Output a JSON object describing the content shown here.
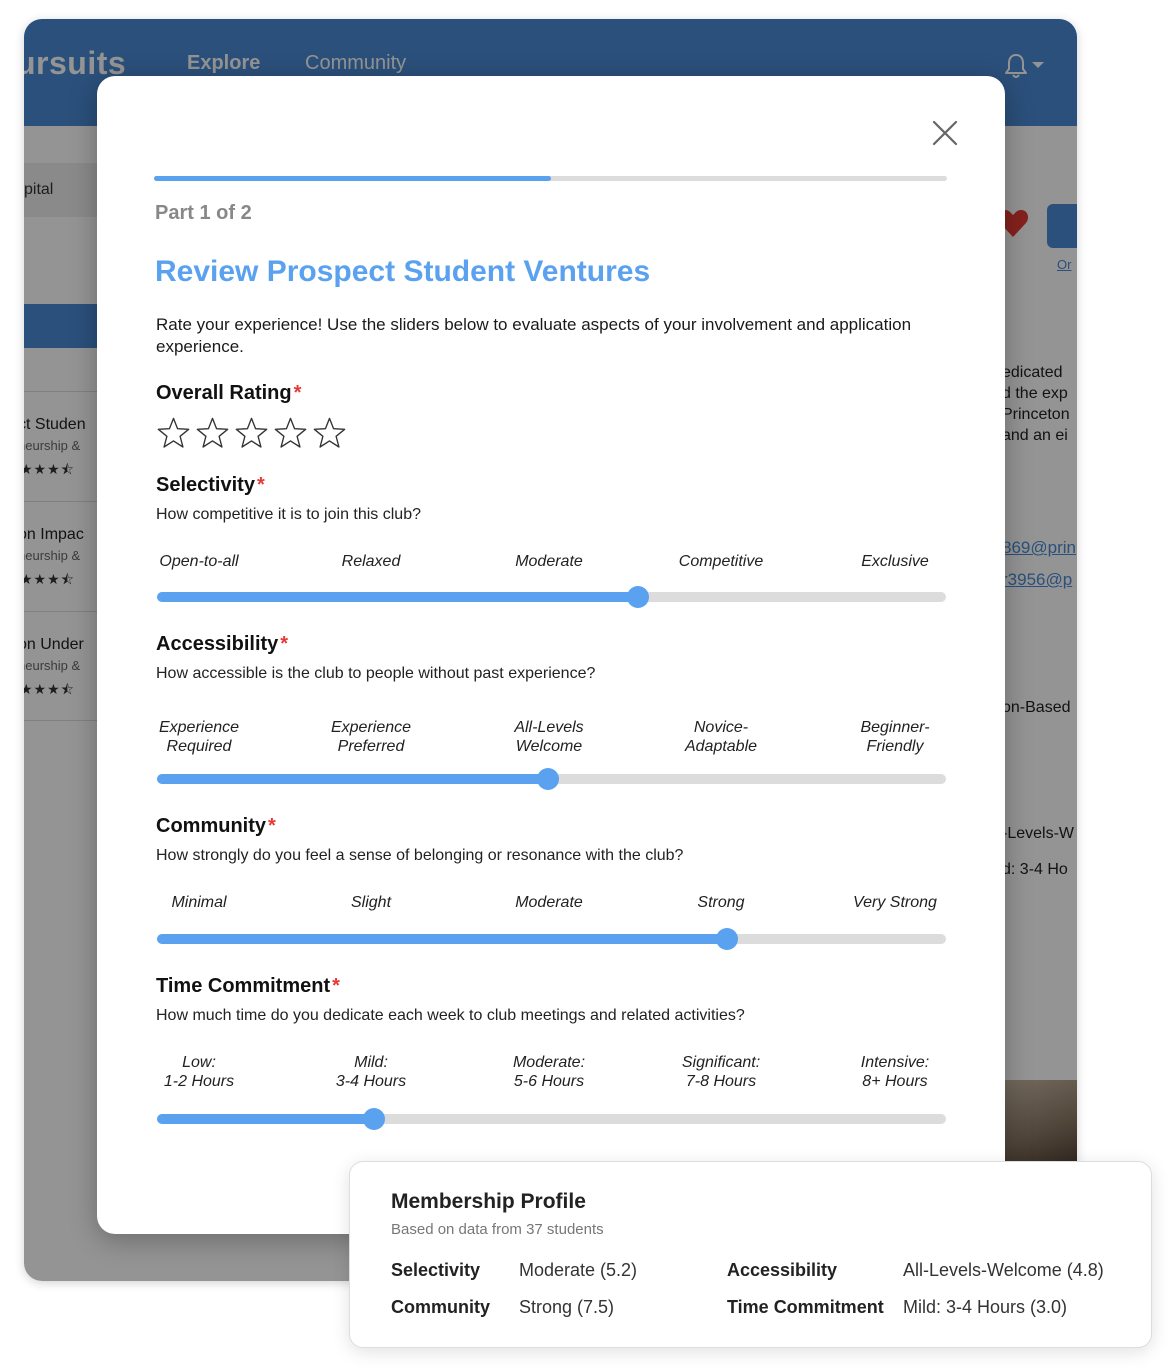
{
  "app": {
    "logo": "ursuits",
    "nav": {
      "explore": "Explore",
      "community": "Community"
    },
    "sidebar_chip": "pital",
    "list": [
      {
        "title": "ct Studen",
        "sub": "neurship &",
        "stars": "★★★⯪"
      },
      {
        "title": "on Impac",
        "sub": "neurship &",
        "stars": "★★★⯪"
      },
      {
        "title": "on Under",
        "sub": "neurship &",
        "stars": "★★★⯪"
      }
    ],
    "follow_link": "Or",
    "right_desc": [
      "edicated",
      "d the exp",
      "Princeton",
      "and an ei"
    ],
    "emails": [
      "869@prin",
      "r3956@p"
    ],
    "right_tags": [
      "on-Based",
      "-Levels-W",
      "d: 3-4 Ho"
    ]
  },
  "modal": {
    "progress": 0.5,
    "part": "Part 1 of 2",
    "title": "Review Prospect Student Ventures",
    "intro": "Rate your experience! Use the sliders below to evaluate aspects of your involvement and application experience.",
    "required_mark": "*",
    "overall": {
      "label": "Overall Rating",
      "rating": 0,
      "max": 5
    },
    "selectivity": {
      "label": "Selectivity",
      "question": "How competitive it is to join this club?",
      "scale": [
        "Open-to-all",
        "Relaxed",
        "Moderate",
        "Competitive",
        "Exclusive"
      ],
      "value": 0.61
    },
    "accessibility": {
      "label": "Accessibility",
      "question": "How accessible is the club to people without past experience?",
      "scale": [
        "Experience\nRequired",
        "Experience\nPreferred",
        "All-Levels\nWelcome",
        "Novice-\nAdaptable",
        "Beginner-\nFriendly"
      ],
      "value": 0.495
    },
    "community": {
      "label": "Community",
      "question": "How strongly do you feel a sense of belonging or resonance with the club?",
      "scale": [
        "Minimal",
        "Slight",
        "Moderate",
        "Strong",
        "Very Strong"
      ],
      "value": 0.722
    },
    "time": {
      "label": "Time Commitment",
      "question": "How much time do you dedicate each week to club meetings and related activities?",
      "scale": [
        "Low:\n1-2 Hours",
        "Mild:\n3-4 Hours",
        "Moderate:\n5-6 Hours",
        "Significant:\n7-8 Hours",
        "Intensive:\n8+ Hours"
      ],
      "value": 0.275
    }
  },
  "profile": {
    "title": "Membership Profile",
    "subtitle": "Based on data from 37 students",
    "selectivity_key": "Selectivity",
    "selectivity_val": "Moderate (5.2)",
    "accessibility_key": "Accessibility",
    "accessibility_val": "All-Levels-Welcome (4.8)",
    "community_key": "Community",
    "community_val": "Strong (7.5)",
    "time_key": "Time Commitment",
    "time_val": "Mild: 3-4 Hours (3.0)"
  },
  "colors": {
    "accent": "#5aa2ef",
    "header": "#4a8ad4",
    "required": "#e53935",
    "track": "#dcdcdc"
  }
}
